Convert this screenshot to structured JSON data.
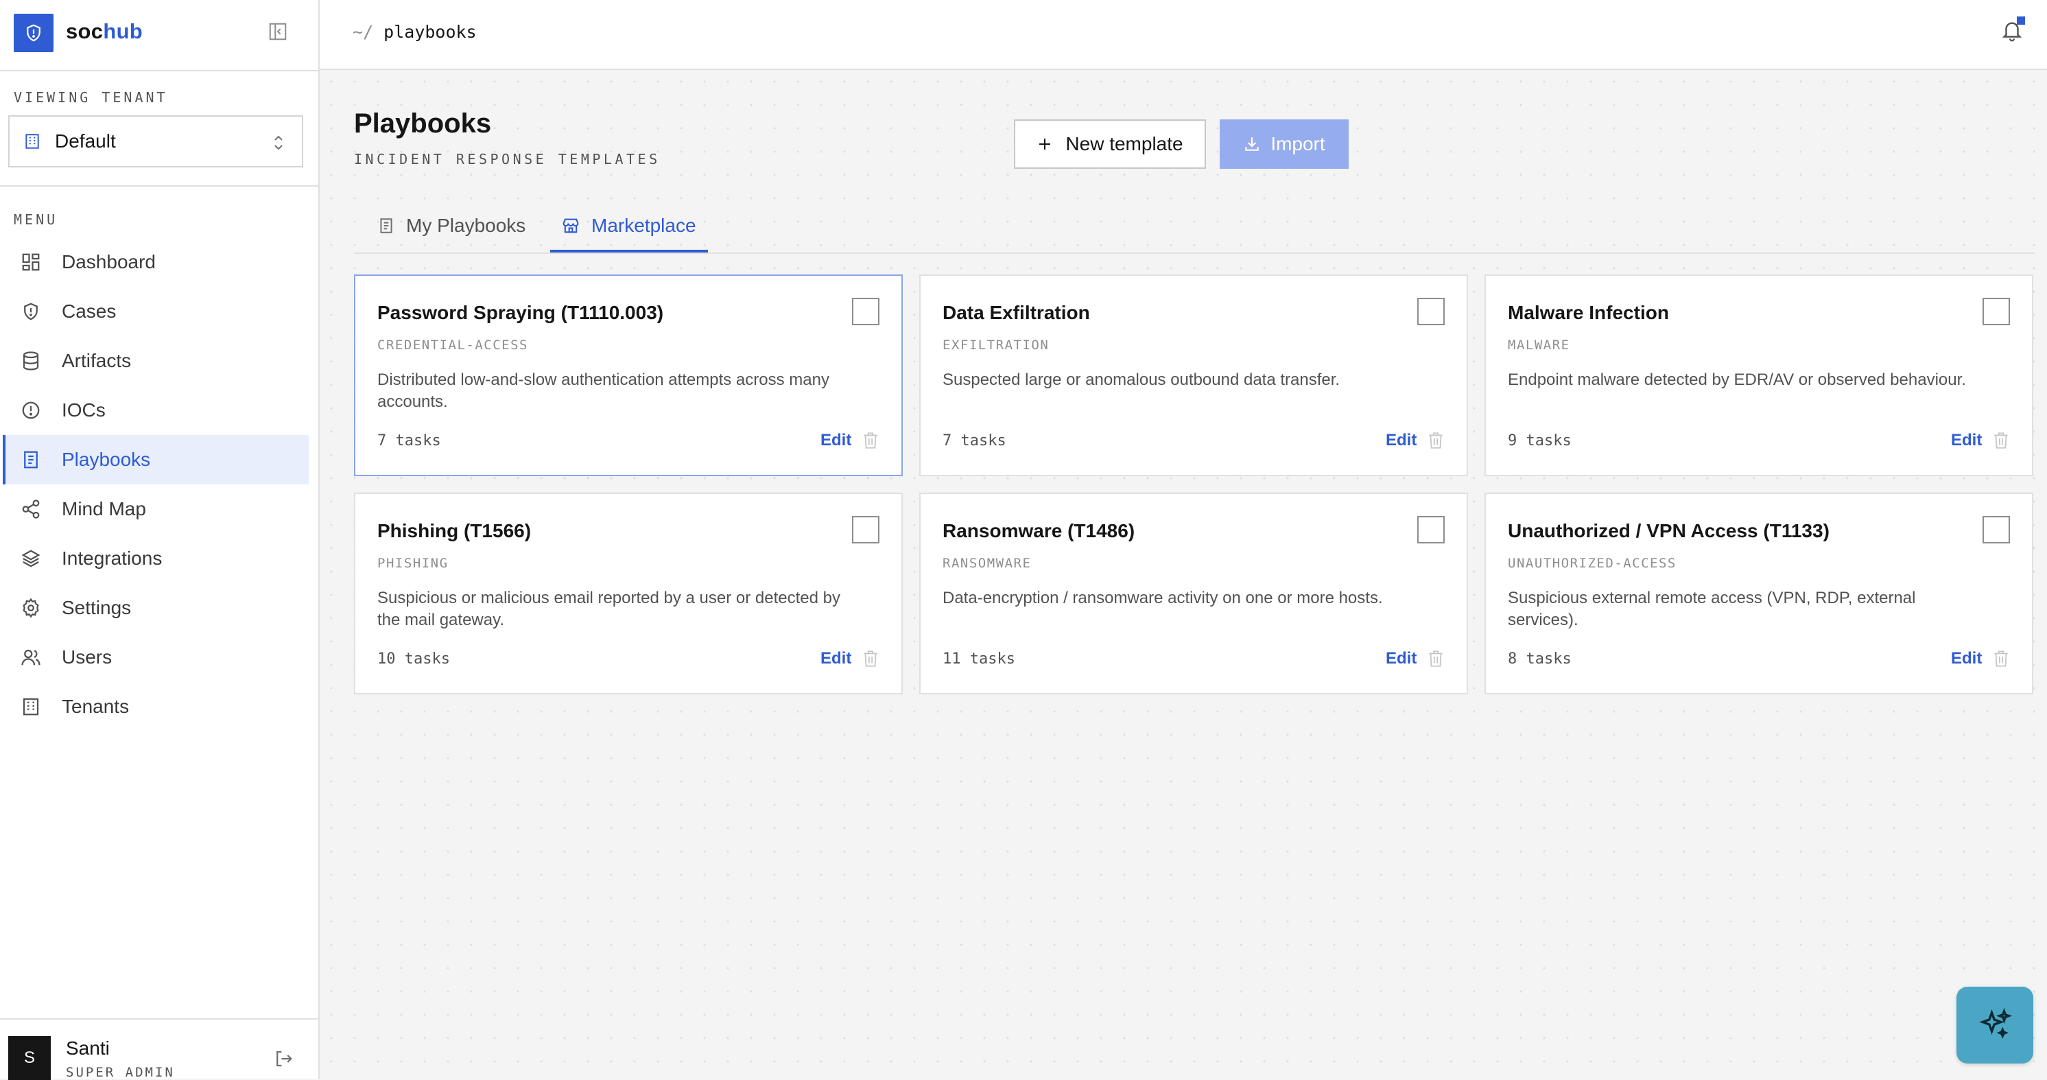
{
  "brand": {
    "name_part1": "soc",
    "name_part2": "hub"
  },
  "sidebar": {
    "tenant_label": "VIEWING TENANT",
    "tenant_value": "Default",
    "menu_label": "MENU",
    "items": [
      {
        "label": "Dashboard",
        "icon": "dashboard-icon"
      },
      {
        "label": "Cases",
        "icon": "shield-icon"
      },
      {
        "label": "Artifacts",
        "icon": "database-icon"
      },
      {
        "label": "IOCs",
        "icon": "alert-circle-icon"
      },
      {
        "label": "Playbooks",
        "icon": "playbook-icon",
        "active": true
      },
      {
        "label": "Mind Map",
        "icon": "share-icon"
      },
      {
        "label": "Integrations",
        "icon": "layers-icon"
      },
      {
        "label": "Settings",
        "icon": "gear-icon"
      },
      {
        "label": "Users",
        "icon": "users-icon"
      },
      {
        "label": "Tenants",
        "icon": "building-icon"
      }
    ],
    "user": {
      "initial": "S",
      "name": "Santi",
      "role": "SUPER ADMIN"
    }
  },
  "topbar": {
    "crumb_prefix": "~/",
    "crumb_path": "playbooks"
  },
  "page": {
    "title": "Playbooks",
    "subtitle": "INCIDENT RESPONSE TEMPLATES",
    "new_template_label": "New template",
    "import_label": "Import"
  },
  "tabs": {
    "my_playbooks": "My Playbooks",
    "marketplace": "Marketplace",
    "active": "marketplace"
  },
  "cards": [
    {
      "title": "Password Spraying (T1110.003)",
      "category": "CREDENTIAL-ACCESS",
      "description": "Distributed low-and-slow authentication attempts across many accounts.",
      "tasks": "7 tasks",
      "edit": "Edit",
      "selected": true
    },
    {
      "title": "Data Exfiltration",
      "category": "EXFILTRATION",
      "description": "Suspected large or anomalous outbound data transfer.",
      "tasks": "7 tasks",
      "edit": "Edit"
    },
    {
      "title": "Malware Infection",
      "category": "MALWARE",
      "description": "Endpoint malware detected by EDR/AV or observed behaviour.",
      "tasks": "9 tasks",
      "edit": "Edit"
    },
    {
      "title": "Phishing (T1566)",
      "category": "PHISHING",
      "description": "Suspicious or malicious email reported by a user or detected by the mail gateway.",
      "tasks": "10 tasks",
      "edit": "Edit"
    },
    {
      "title": "Ransomware (T1486)",
      "category": "RANSOMWARE",
      "description": "Data-encryption / ransomware activity on one or more hosts.",
      "tasks": "11 tasks",
      "edit": "Edit"
    },
    {
      "title": "Unauthorized / VPN Access (T1133)",
      "category": "UNAUTHORIZED-ACCESS",
      "description": "Suspicious external remote access (VPN, RDP, external services).",
      "tasks": "8 tasks",
      "edit": "Edit"
    }
  ],
  "colors": {
    "accent": "#2f5bd3",
    "import_button": "#95acee",
    "fab": "#4aa6c4",
    "active_nav_bg": "#e8eefb"
  }
}
